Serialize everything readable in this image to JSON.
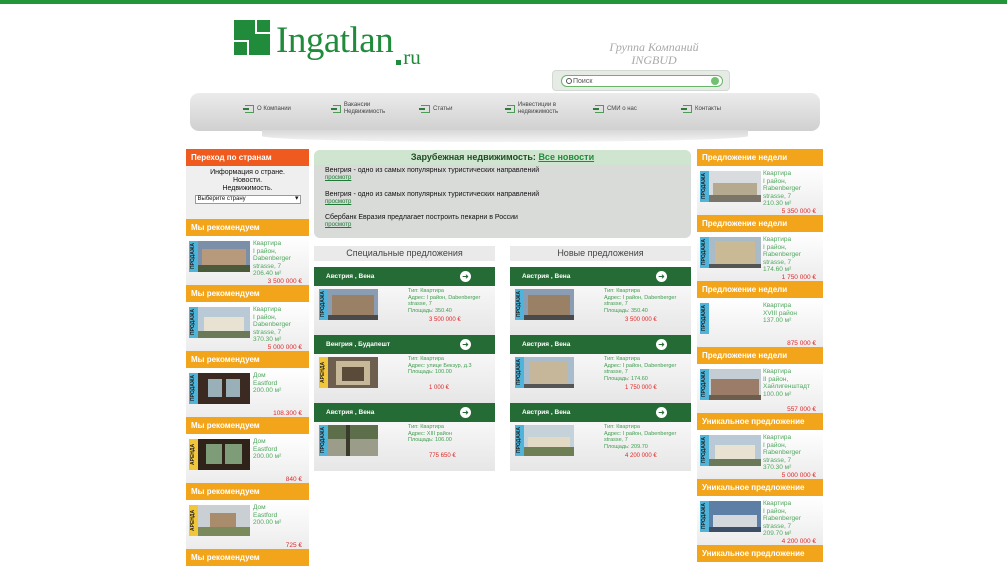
{
  "logo": {
    "name": "Ingatlan",
    "ru": "ru"
  },
  "company": {
    "line1": "Группа Компаний",
    "line2": "INGBUD"
  },
  "search": {
    "value": "Поиск"
  },
  "nav": [
    "О Компании",
    "Вакансии Недвижимость",
    "Статьи",
    "Инвестиции в недвижимость",
    "СМИ о нас",
    "Контакты"
  ],
  "countries": {
    "title": "Переход по странам",
    "text": "Информация о стране. Новости. Недвижимость.",
    "select": "Выберите страну"
  },
  "left_cards": [
    {
      "head": "Мы рекомендуем",
      "tag": "ПРОДАЖА",
      "lines": [
        "Квартира",
        "I район,",
        "Dabenberger",
        "strasse, 7",
        "206.40 м²"
      ],
      "price": "3 500 000 €"
    },
    {
      "head": "Мы рекомендуем",
      "tag": "ПРОДАЖА",
      "lines": [
        "Квартира",
        "I район,",
        "Dabenberger",
        "strasse, 7",
        "370.30 м²"
      ],
      "price": "5 000 000 €"
    },
    {
      "head": "Мы рекомендуем",
      "tag": "ПРОДАЖА",
      "lines": [
        "Дом",
        "Eastford",
        "200.00 м²"
      ],
      "price": "108.300 €"
    },
    {
      "head": "Мы рекомендуем",
      "tag": "АРЕНДА",
      "lines": [
        "Дом",
        "Eastford",
        "200.00 м²"
      ],
      "price": "840 €"
    },
    {
      "head": "Мы рекомендуем",
      "tag": "АРЕНДА",
      "lines": [
        "Дом",
        "Eastford",
        "200.00 м²"
      ],
      "price": "725 €"
    }
  ],
  "left_last_head": "Мы рекомендуем",
  "news": {
    "title": "Зарубежная недвижимость:",
    "all": "Все новости",
    "items": [
      {
        "text": "Венгрия - одно из самых популярных туристических направлений",
        "link": "просмотр"
      },
      {
        "text": "Венгрия - одно из самых популярных туристических направлений",
        "link": "просмотр"
      },
      {
        "text": "Сбербанк Евразия предлагает построить пекарни в России",
        "link": "просмотр"
      }
    ]
  },
  "special": {
    "title": "Специальные предложения",
    "offers": [
      {
        "head": "Австрия , Вена",
        "tag": "ПРОДАЖА",
        "lines": [
          "Тип: Квартира",
          "Адрес: I район, Dabenberger",
          "strasse, 7",
          "Площадь: 350.40"
        ],
        "price": "3 500 000 €"
      },
      {
        "head": "Венгрия , Будапешт",
        "tag": "АРЕНДА",
        "lines": [
          "Тип: Квартира",
          "Адрес: улице Бекзур, д.3",
          "Площадь: 100.00"
        ],
        "price": "1 000 €"
      },
      {
        "head": "Австрия , Вена",
        "tag": "ПРОДАЖА",
        "lines": [
          "Тип: Квартира",
          "Адрес: XIII район",
          "Площадь: 106.00"
        ],
        "price": "775 650 €"
      }
    ]
  },
  "fresh": {
    "title": "Новые предложения",
    "offers": [
      {
        "head": "Австрия , Вена",
        "tag": "ПРОДАЖА",
        "lines": [
          "Тип: Квартира",
          "Адрес: I район, Dabenberger",
          "strasse, 7",
          "Площадь: 350.40"
        ],
        "price": "3 500 000 €"
      },
      {
        "head": "Австрия , Вена",
        "tag": "ПРОДАЖА",
        "lines": [
          "Тип: Квартира",
          "Адрес: I район, Dabenberger",
          "strasse, 7",
          "Площадь: 174.60"
        ],
        "price": "1 750 000 €"
      },
      {
        "head": "Австрия , Вена",
        "tag": "ПРОДАЖА",
        "lines": [
          "Тип: Квартира",
          "Адрес: I район, Dabenberger",
          "strasse, 7",
          "Площадь: 209.70"
        ],
        "price": "4 200 000 €"
      }
    ]
  },
  "right_cards": [
    {
      "head": "Предложение недели",
      "tag": "ПРОДАЖА",
      "lines": [
        "Квартира",
        "I район,",
        "Rabenberger",
        "strasse, 7",
        "210.30 м²"
      ],
      "price": "5 350 000 €"
    },
    {
      "head": "Предложение недели",
      "tag": "ПРОДАЖА",
      "lines": [
        "Квартира",
        "I район,",
        "Rabenberger",
        "strasse, 7",
        "174.60 м²"
      ],
      "price": "1 750 000 €"
    },
    {
      "head": "Предложение недели",
      "tag": "ПРОДАЖА",
      "lines": [
        "Квартира",
        "XVIII район",
        "137.00 м²"
      ],
      "price": "875 000 €"
    },
    {
      "head": "Предложение недели",
      "tag": "ПРОДАЖА",
      "lines": [
        "Квартира",
        "II район,",
        "Хайлигенштадт",
        "100.00 м²"
      ],
      "price": "557 000 €"
    },
    {
      "head": "Уникальное предложение",
      "tag": "ПРОДАЖА",
      "lines": [
        "Квартира",
        "I район,",
        "Rabenberger",
        "strasse, 7",
        "370.30 м²"
      ],
      "price": "5 000 000 €"
    },
    {
      "head": "Уникальное предложение",
      "tag": "ПРОДАЖА",
      "lines": [
        "Квартира",
        "I район,",
        "Rabenberger",
        "strasse, 7",
        "209.70 м²"
      ],
      "price": "4 200 000 €"
    }
  ],
  "right_last_head": "Уникальное предложение"
}
